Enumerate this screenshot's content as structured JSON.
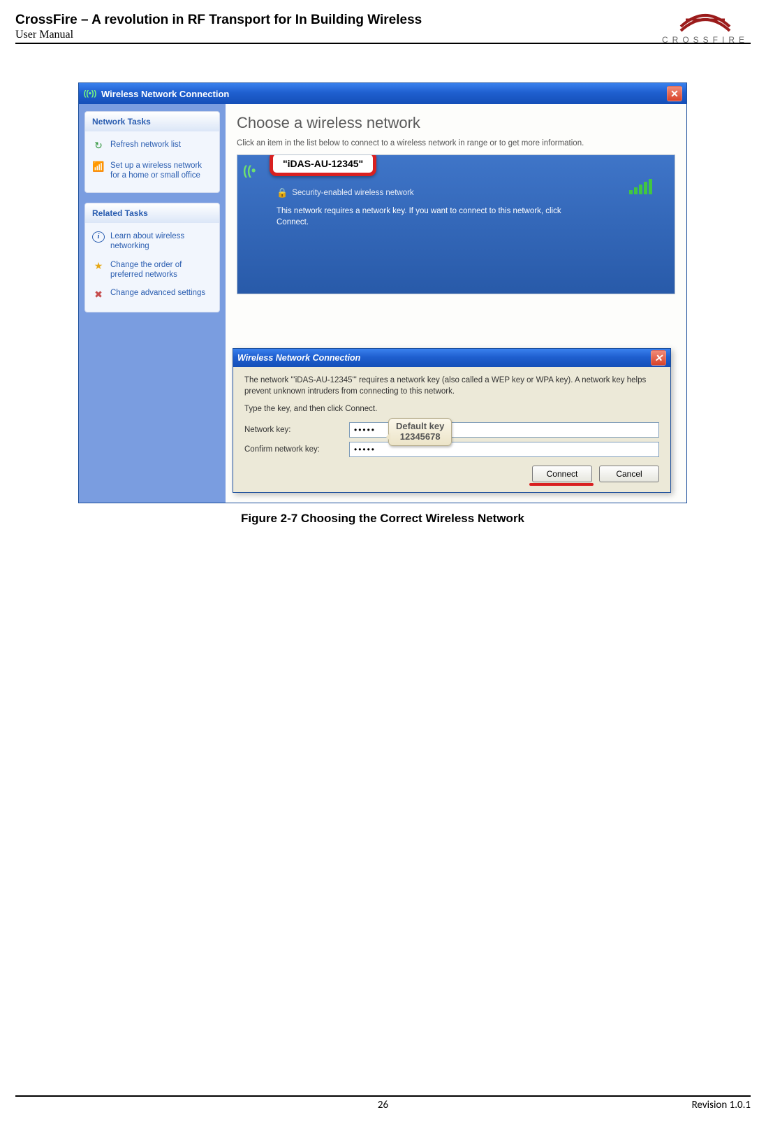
{
  "page": {
    "title": "CrossFire – A revolution in RF Transport for In Building Wireless",
    "subtitle": "User Manual",
    "logo_text": "CROSSFIRE",
    "page_number": "26",
    "revision": "Revision 1.0.1"
  },
  "figure": {
    "caption": "Figure 2-7 Choosing the Correct Wireless Network"
  },
  "window": {
    "title": "Wireless Network Connection",
    "close": "✕",
    "sidebar": {
      "panel1": {
        "title": "Network Tasks",
        "items": [
          "Refresh network list",
          "Set up a wireless network for a home or small office"
        ]
      },
      "panel2": {
        "title": "Related Tasks",
        "items": [
          "Learn about wireless networking",
          "Change the order of preferred networks",
          "Change advanced settings"
        ]
      }
    },
    "main": {
      "heading": "Choose a wireless network",
      "description": "Click an item in the list below to connect to a wireless network in range or to get more information.",
      "ssid_callout": "\"iDAS-AU-12345\"",
      "secure_text": "Security-enabled wireless network",
      "info_text": "This network requires a network key. If you want to connect to this network, click Connect."
    }
  },
  "dialog": {
    "title": "Wireless Network Connection",
    "close": "✕",
    "para1": "The network '\"iDAS-AU-12345\"' requires a network key (also called a WEP key or WPA key). A network key helps prevent unknown intruders from connecting to this network.",
    "para2": "Type the key, and then click Connect.",
    "label_key": "Network key:",
    "label_confirm": "Confirm network key:",
    "key_value": "•••••",
    "confirm_value": "•••••",
    "callout_line1": "Default key",
    "callout_line2": "12345678",
    "btn_connect": "Connect",
    "btn_cancel": "Cancel"
  }
}
